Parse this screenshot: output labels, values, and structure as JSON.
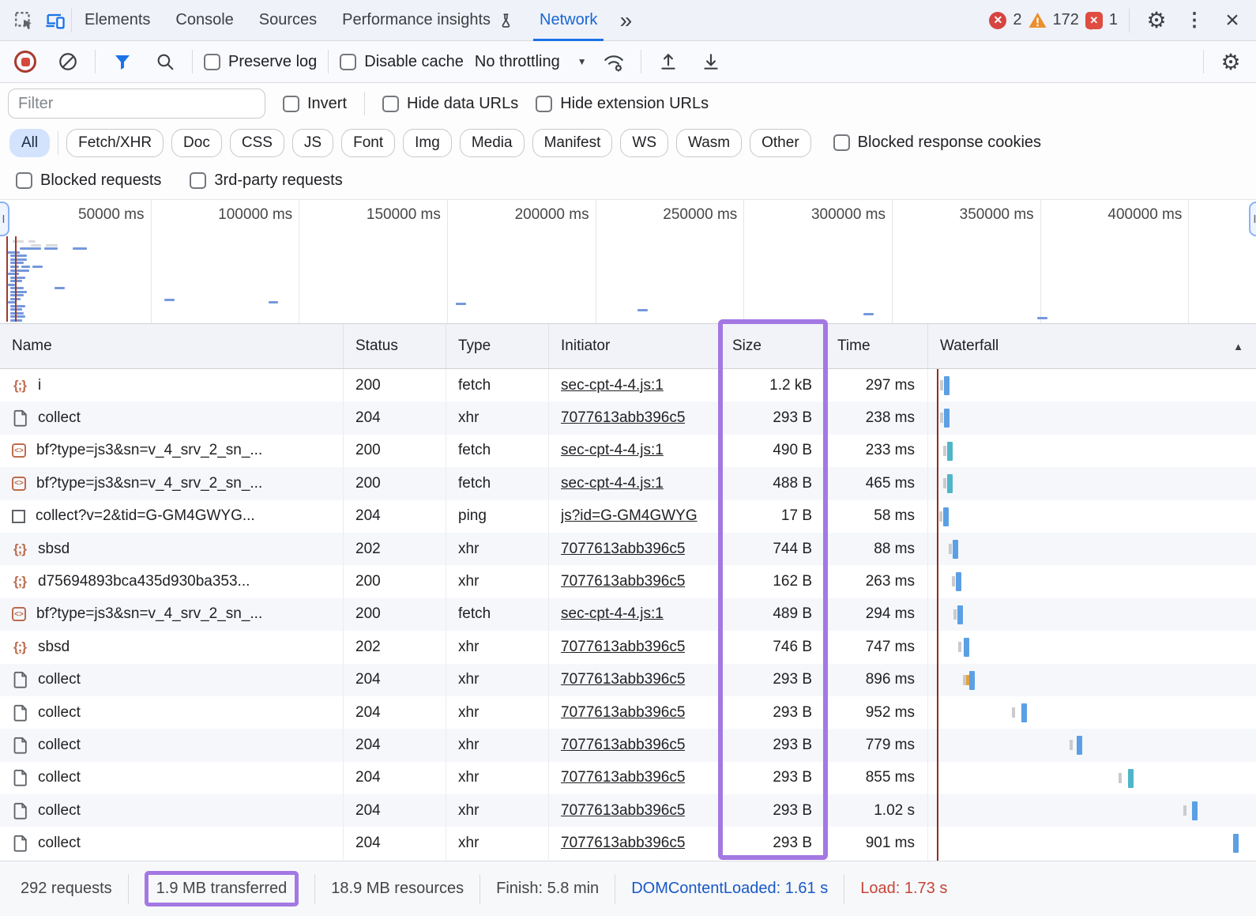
{
  "tab_bar": {
    "tabs": [
      "Elements",
      "Console",
      "Sources",
      "Performance insights",
      "Network"
    ],
    "more_tabs": "»",
    "error_count": "2",
    "warning_count": "172",
    "issues_count": "1"
  },
  "toolbar": {
    "preserve_log": "Preserve log",
    "disable_cache": "Disable cache",
    "throttling": "No throttling"
  },
  "filter_bar": {
    "filter_placeholder": "Filter",
    "invert": "Invert",
    "hide_data_urls": "Hide data URLs",
    "hide_extension_urls": "Hide extension URLs"
  },
  "chips": [
    {
      "label": "All",
      "active": true
    },
    {
      "label": "Fetch/XHR",
      "divider_before": true
    },
    {
      "label": "Doc"
    },
    {
      "label": "CSS"
    },
    {
      "label": "JS"
    },
    {
      "label": "Font"
    },
    {
      "label": "Img"
    },
    {
      "label": "Media"
    },
    {
      "label": "Manifest"
    },
    {
      "label": "WS"
    },
    {
      "label": "Wasm"
    },
    {
      "label": "Other"
    }
  ],
  "blocked_response_cookies": "Blocked response cookies",
  "secondary_filters": {
    "blocked_requests": "Blocked requests",
    "third_party_requests": "3rd-party requests"
  },
  "overview": {
    "ticks": [
      "50000 ms",
      "100000 ms",
      "150000 ms",
      "200000 ms",
      "250000 ms",
      "300000 ms",
      "350000 ms",
      "400000 ms"
    ],
    "tick_start_x": 190.5,
    "tick_spacing": 187.7,
    "red_lines": [
      8,
      19
    ],
    "bars": [
      [
        16,
        303,
        14,
        "g"
      ],
      [
        36,
        303,
        9,
        "g"
      ],
      [
        39,
        308,
        13,
        "g"
      ],
      [
        58,
        308,
        15,
        "g"
      ],
      [
        25,
        312,
        27,
        "b"
      ],
      [
        56,
        312,
        17,
        "b"
      ],
      [
        92,
        312,
        18,
        "b"
      ],
      [
        8,
        317,
        17,
        "b"
      ],
      [
        13,
        321,
        21,
        "b"
      ],
      [
        13,
        326,
        21,
        "b"
      ],
      [
        13,
        330,
        17,
        "b"
      ],
      [
        13,
        335,
        11,
        "b"
      ],
      [
        27,
        335,
        11,
        "b"
      ],
      [
        41,
        335,
        13,
        "b"
      ],
      [
        13,
        340,
        24,
        "b"
      ],
      [
        10,
        344,
        14,
        "b"
      ],
      [
        13,
        349,
        19,
        "b"
      ],
      [
        13,
        353,
        15,
        "b"
      ],
      [
        10,
        358,
        9,
        "b"
      ],
      [
        13,
        362,
        17,
        "b"
      ],
      [
        69,
        362,
        13,
        "b"
      ],
      [
        13,
        367,
        21,
        "b"
      ],
      [
        13,
        371,
        17,
        "b"
      ],
      [
        13,
        376,
        13,
        "b"
      ],
      [
        10,
        380,
        11,
        "b"
      ],
      [
        13,
        385,
        19,
        "b"
      ],
      [
        13,
        389,
        15,
        "b"
      ],
      [
        13,
        394,
        17,
        "b"
      ],
      [
        13,
        398,
        19,
        "b"
      ],
      [
        13,
        403,
        15,
        "b"
      ],
      [
        208,
        377,
        13,
        "b"
      ],
      [
        340,
        380,
        12,
        "b"
      ],
      [
        577,
        382,
        13,
        "b"
      ],
      [
        807,
        390,
        13,
        "b"
      ],
      [
        1093,
        395,
        13,
        "b"
      ],
      [
        1313,
        400,
        13,
        "b"
      ]
    ]
  },
  "table": {
    "columns": {
      "name": "Name",
      "status": "Status",
      "type": "Type",
      "initiator": "Initiator",
      "size": "Size",
      "time": "Time",
      "waterfall": "Waterfall"
    },
    "sort_icon": "▲",
    "rows": [
      {
        "icon": "braces",
        "name": "i",
        "status": "200",
        "type": "fetch",
        "initiator": "sec-cpt-4-4.js:1",
        "size": "1.2 kB",
        "time": "297 ms",
        "wf": {
          "tick": 15,
          "bar": 20,
          "color": "blue"
        }
      },
      {
        "icon": "doc",
        "name": "collect",
        "status": "204",
        "type": "xhr",
        "initiator": "7077613abb396c5",
        "size": "293 B",
        "time": "238 ms",
        "wf": {
          "tick": 15,
          "bar": 20,
          "color": "blue"
        }
      },
      {
        "icon": "script",
        "name": "bf?type=js3&sn=v_4_srv_2_sn_...",
        "status": "200",
        "type": "fetch",
        "initiator": "sec-cpt-4-4.js:1",
        "size": "490 B",
        "time": "233 ms",
        "wf": {
          "tick": 19,
          "bar": 24,
          "color": "teal"
        }
      },
      {
        "icon": "script",
        "name": "bf?type=js3&sn=v_4_srv_2_sn_...",
        "status": "200",
        "type": "fetch",
        "initiator": "sec-cpt-4-4.js:1",
        "size": "488 B",
        "time": "465 ms",
        "wf": {
          "tick": 19,
          "bar": 24,
          "color": "teal"
        }
      },
      {
        "icon": "square",
        "name": "collect?v=2&tid=G-GM4GWYG...",
        "status": "204",
        "type": "ping",
        "initiator": "js?id=G-GM4GWYG",
        "size": "17 B",
        "time": "58 ms",
        "wf": {
          "tick": 14,
          "bar": 19,
          "color": "blue"
        }
      },
      {
        "icon": "braces",
        "name": "sbsd",
        "status": "202",
        "type": "xhr",
        "initiator": "7077613abb396c5",
        "size": "744 B",
        "time": "88 ms",
        "wf": {
          "tick": 26,
          "bar": 31,
          "color": "blue"
        }
      },
      {
        "icon": "braces",
        "name": "d75694893bca435d930ba353...",
        "status": "200",
        "type": "xhr",
        "initiator": "7077613abb396c5",
        "size": "162 B",
        "time": "263 ms",
        "wf": {
          "tick": 30,
          "bar": 35,
          "color": "blue"
        }
      },
      {
        "icon": "script",
        "name": "bf?type=js3&sn=v_4_srv_2_sn_...",
        "status": "200",
        "type": "fetch",
        "initiator": "sec-cpt-4-4.js:1",
        "size": "489 B",
        "time": "294 ms",
        "wf": {
          "tick": 32,
          "bar": 37,
          "color": "blue"
        }
      },
      {
        "icon": "braces",
        "name": "sbsd",
        "status": "202",
        "type": "xhr",
        "initiator": "7077613abb396c5",
        "size": "746 B",
        "time": "747 ms",
        "wf": {
          "tick": 38,
          "bar": 45,
          "color": "blue"
        }
      },
      {
        "icon": "doc",
        "name": "collect",
        "status": "204",
        "type": "xhr",
        "initiator": "7077613abb396c5",
        "size": "293 B",
        "time": "896 ms",
        "wf": {
          "tick": 44,
          "tick2": 48,
          "bar": 52,
          "color": "blue"
        }
      },
      {
        "icon": "doc",
        "name": "collect",
        "status": "204",
        "type": "xhr",
        "initiator": "7077613abb396c5",
        "size": "293 B",
        "time": "952 ms",
        "wf": {
          "tick": 106,
          "bar": 118,
          "color": "blue"
        }
      },
      {
        "icon": "doc",
        "name": "collect",
        "status": "204",
        "type": "xhr",
        "initiator": "7077613abb396c5",
        "size": "293 B",
        "time": "779 ms",
        "wf": {
          "tick": 179,
          "bar": 188,
          "color": "blue"
        }
      },
      {
        "icon": "doc",
        "name": "collect",
        "status": "204",
        "type": "xhr",
        "initiator": "7077613abb396c5",
        "size": "293 B",
        "time": "855 ms",
        "wf": {
          "tick": 241,
          "bar": 253,
          "color": "teal"
        }
      },
      {
        "icon": "doc",
        "name": "collect",
        "status": "204",
        "type": "xhr",
        "initiator": "7077613abb396c5",
        "size": "293 B",
        "time": "1.02 s",
        "wf": {
          "tick": 323,
          "bar": 334,
          "color": "blue"
        }
      },
      {
        "icon": "doc",
        "name": "collect",
        "status": "204",
        "type": "xhr",
        "initiator": "7077613abb396c5",
        "size": "293 B",
        "time": "901 ms",
        "wf": {
          "bar": 386,
          "color": "blue"
        }
      }
    ]
  },
  "status_bar": {
    "requests": "292 requests",
    "transferred": "1.9 MB transferred",
    "resources": "18.9 MB resources",
    "finish": "Finish: 5.8 min",
    "dom_content_loaded": "DOMContentLoaded: 1.61 s",
    "load": "Load: 1.73 s"
  },
  "colors": {
    "accent_blue": "#1a73e8",
    "annotation_purple": "#a478e3",
    "error_red": "#d64541",
    "warning_orange": "#eb8f2f",
    "dcl_blue": "#1958c7",
    "load_red": "#c74438"
  }
}
